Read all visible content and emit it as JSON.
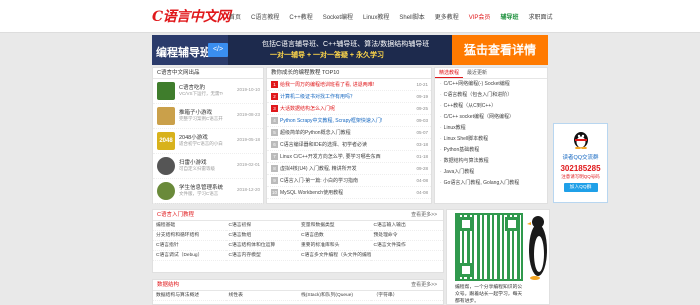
{
  "header": {
    "logo": "C语言中文网",
    "nav": [
      "首页",
      "C语言教程",
      "C++教程",
      "Socket编程",
      "Linux教程",
      "Shell脚本",
      "更多教程",
      "VIP会员",
      "辅导班",
      "求职面试"
    ]
  },
  "banner": {
    "left_title": "编程辅导班",
    "line1": "包括C语言辅导班、C++辅导班、算法/数据结构辅导班",
    "line2": "一对一辅导 + 一对一答疑 + 永久学习",
    "cta": "猛击查看详情"
  },
  "games": {
    "title": "C语言中文网出品",
    "items": [
      {
        "title": "C语言吃豹",
        "desc": "VC/VS下运行，无需TC",
        "date": "2019-10-10",
        "icon_color": "#3f7d2c"
      },
      {
        "title": "推箱子小游戏",
        "desc": "完整学习案例C语言开发",
        "date": "2019-08-23",
        "icon_color": "#caa04a"
      },
      {
        "title": "2048小游戏",
        "desc": "适合初学C语言的小白",
        "date": "2019-05-18",
        "icon_color": "#d8b21c"
      },
      {
        "title": "扫雷小游戏",
        "desc": "可自定义扫雷等级",
        "date": "2019-02-01",
        "icon_color": "#555555"
      },
      {
        "title": "学生信息管理系统",
        "desc": "文件版，学习C语言",
        "date": "2018-12-20",
        "icon_color": "#6a8a3a"
      }
    ]
  },
  "top10": {
    "title": "教你成长的编程教程 TOP10",
    "items": [
      {
        "num": "1",
        "text": "给我一周万的编程培训班看了看, 进退两难!",
        "date": "10-21",
        "style": "red"
      },
      {
        "num": "2",
        "text": "计算机二级证书对找工作有用吗？",
        "date": "09-19",
        "style": "blue"
      },
      {
        "num": "3",
        "text": "大话数据结构怎么入门呢",
        "date": "09-25",
        "style": "red"
      },
      {
        "num": "4",
        "text": "Python Scrapy中文教程, Scrapy框架快速入门!",
        "date": "09-03",
        "style": "blue"
      },
      {
        "num": "5",
        "text": "超级简单的Python概念入门教程",
        "date": "05-07",
        "style": ""
      },
      {
        "num": "6",
        "text": "C语言编译器和IDE的选择、初学者必读",
        "date": "03-18",
        "style": ""
      },
      {
        "num": "7",
        "text": "Linux C/C++开发方向怎么学, 要学习哪些东西",
        "date": "01-18",
        "style": ""
      },
      {
        "num": "8",
        "text": "虚拟4核(U4) 入门教程, 精讲所开发",
        "date": "09-28",
        "style": ""
      },
      {
        "num": "9",
        "text": "C语言入门-第一篇: 小白的学习指南",
        "date": "04-08",
        "style": ""
      },
      {
        "num": "10",
        "text": "MySQL Workbench使用教程",
        "date": "04-08",
        "style": ""
      }
    ]
  },
  "recommend": {
    "tabs": [
      "精选教程",
      "最近更新"
    ],
    "items": [
      "C/C++网络编程(-) Socket编程",
      "C语言教程（包含入门和进阶）",
      "C++教程（从C到C++）",
      "C/C++ socket编程（网络编程）",
      "Linux教程",
      "Linux Shell脚本教程",
      "Python基础教程",
      "数据结构与算法教程",
      "Java入门教程",
      "Go语言入门教程, Golang入门教程"
    ]
  },
  "tutorial": {
    "title": "C语言入门教程",
    "more": "查看更多>>",
    "cells": [
      "编程基础",
      "C语言初探",
      "变量和数据类型",
      "C语言输入输出",
      "分支结构和循环结构",
      "C语言数组",
      "C语言函数",
      "预处理命令",
      "C语言指针",
      "C语言结构体和位运算",
      "重要的标准库和头",
      "C语言文件操作",
      "C语言调试（Debug）",
      "C语言内存模型",
      "C语言多文件编程（头文件的编程）",
      ""
    ]
  },
  "datastruct": {
    "title": "数据结构",
    "more": "查看更多>>",
    "cells": [
      "数据结构与算法概述",
      "线性表",
      "栈(Stack)和队列(Queue)",
      "（字符串）"
    ]
  },
  "qr": {
    "caption": "编程帮，一个分享编程知识的公众号。跟着站长一起学习，每天都有进步。"
  },
  "qq": {
    "title": "读者QQ交流群",
    "number": "302185285",
    "note": "注意请写明QQ号码",
    "button": "加入QQ群"
  }
}
